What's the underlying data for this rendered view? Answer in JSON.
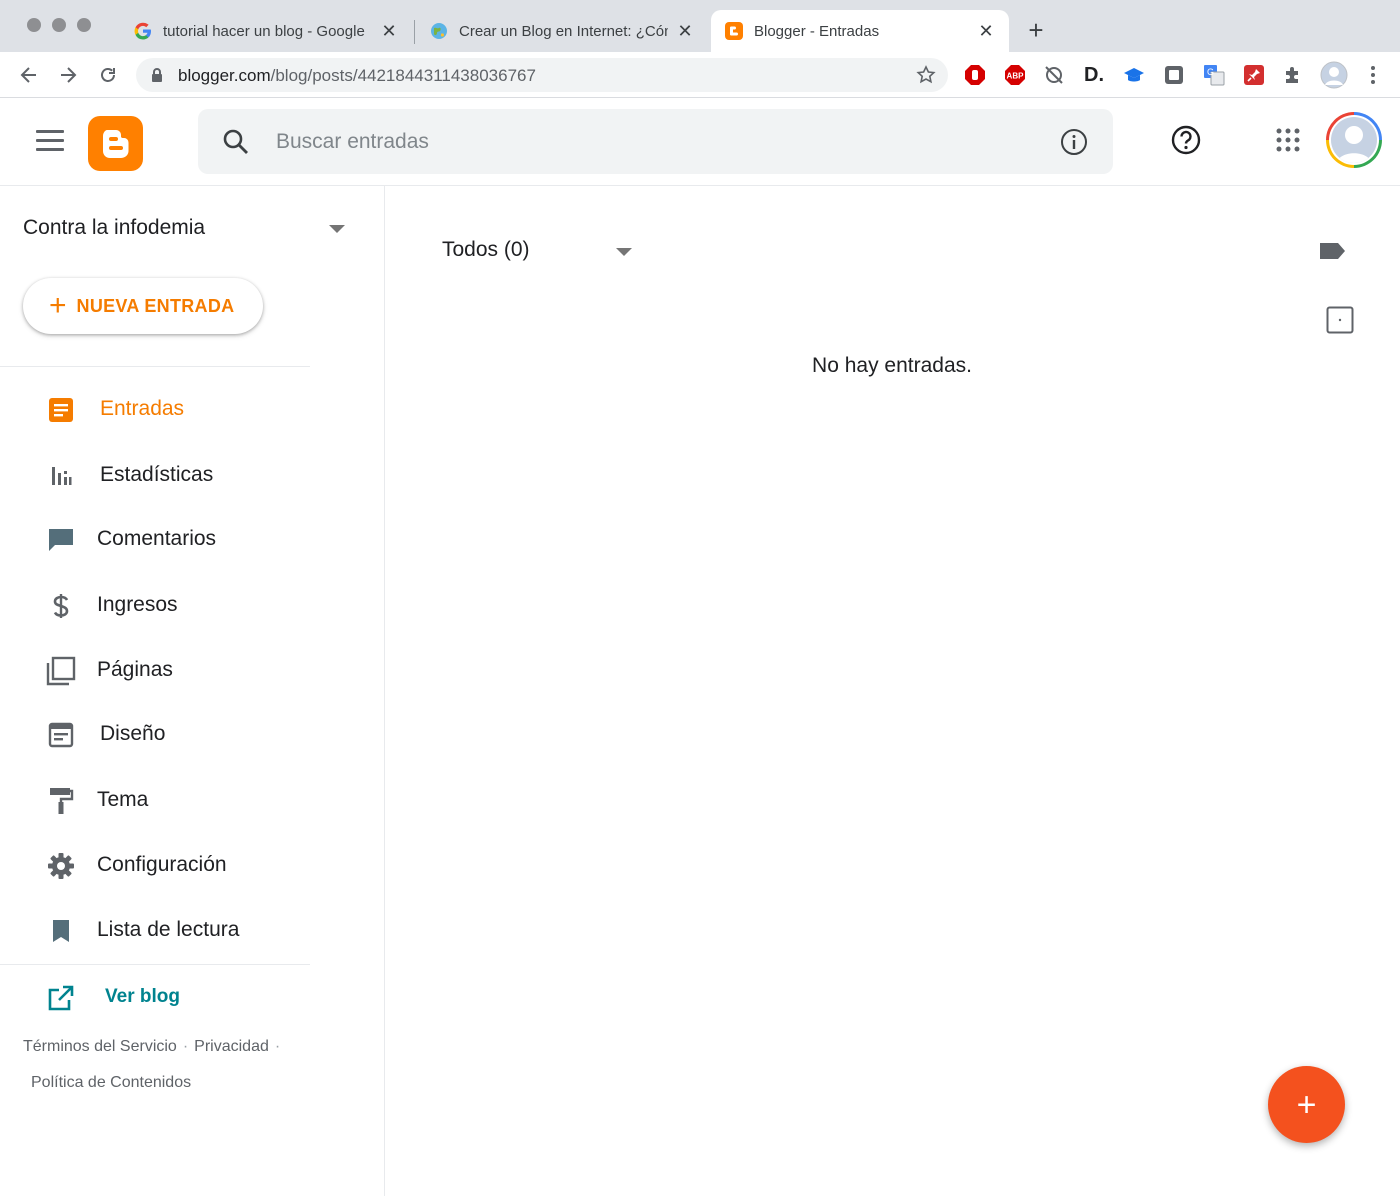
{
  "browser": {
    "tabs": [
      {
        "title": "tutorial hacer un blog - Google",
        "favicon": "google-icon",
        "active": false
      },
      {
        "title": "Crear un Blog en Internet: ¿Cóm",
        "favicon": "globe-icon",
        "active": false
      },
      {
        "title": "Blogger - Entradas",
        "favicon": "blogger-icon",
        "active": true
      }
    ],
    "close_glyph": "✕",
    "new_tab_glyph": "+",
    "url_host": "blogger.com",
    "url_path": "/blog/posts/4421844311438036767",
    "extensions": [
      "stop-icon",
      "adblock-icon",
      "no-tracking-icon",
      "d-extension-icon",
      "graduation-cap-icon",
      "screenshot-icon",
      "translate-icon",
      "pin-icon",
      "puzzle-icon",
      "profile-icon",
      "menu-dots-icon"
    ],
    "adblock_label": "ABP",
    "d_label": "D."
  },
  "app": {
    "search_placeholder": "Buscar entradas",
    "accent": "#f57c00",
    "fab_color": "#f4511e"
  },
  "sidebar": {
    "blog_name": "Contra la infodemia",
    "new_post_plus": "+",
    "new_post_label": "NUEVA ENTRADA",
    "items": [
      {
        "label": "Entradas",
        "icon": "posts-icon",
        "active": true
      },
      {
        "label": "Estadísticas",
        "icon": "stats-icon",
        "active": false
      },
      {
        "label": "Comentarios",
        "icon": "comments-icon",
        "active": false
      },
      {
        "label": "Ingresos",
        "icon": "dollar-icon",
        "active": false
      },
      {
        "label": "Páginas",
        "icon": "pages-icon",
        "active": false
      },
      {
        "label": "Diseño",
        "icon": "layout-icon",
        "active": false
      },
      {
        "label": "Tema",
        "icon": "paint-roller-icon",
        "active": false
      },
      {
        "label": "Configuración",
        "icon": "gear-icon",
        "active": false
      },
      {
        "label": "Lista de lectura",
        "icon": "bookmark-icon",
        "active": false
      }
    ],
    "view_blog": "Ver blog",
    "footer": {
      "terms": "Términos del Servicio",
      "privacy": "Privacidad",
      "content_policy": "Política de Contenidos",
      "separator": "·"
    }
  },
  "main": {
    "filter_label": "Todos (0)",
    "empty_message": "No hay entradas.",
    "fab_plus": "+"
  }
}
